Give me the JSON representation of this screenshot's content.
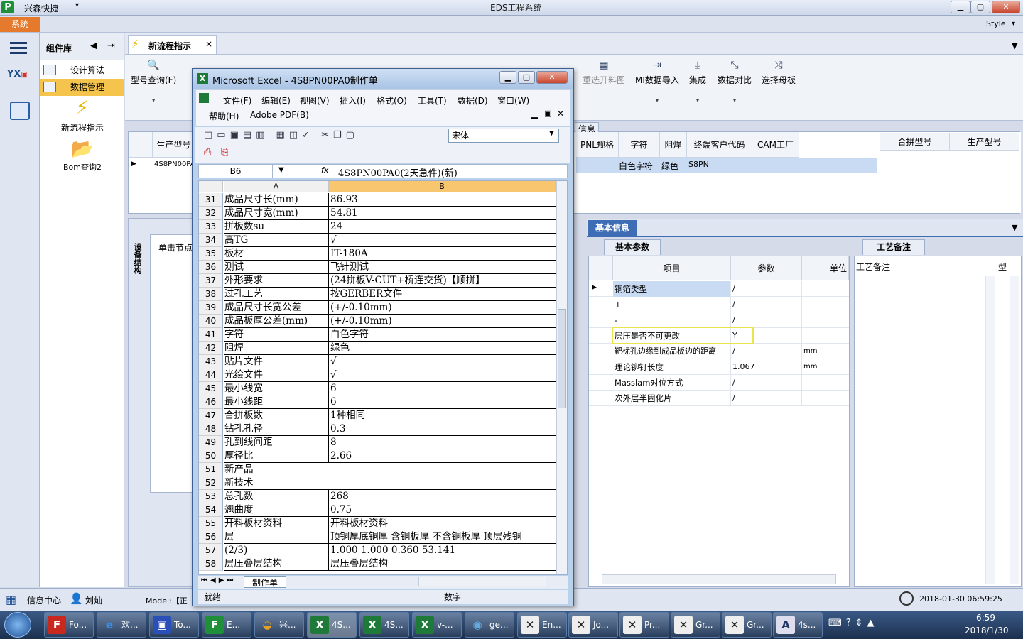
{
  "titlebar": {
    "app_name": "兴森快捷",
    "center_title": "EDS工程系统",
    "min": "▁",
    "max": "▢",
    "close": "✕"
  },
  "menu": {
    "system": "系统",
    "style": "Style"
  },
  "compnav": {
    "title": "组件库",
    "items": [
      {
        "label": "设计算法"
      },
      {
        "label": "数据管理"
      }
    ],
    "big_items": [
      {
        "label": "新流程指示"
      },
      {
        "label": "Bom查询2"
      }
    ]
  },
  "main_tab": {
    "label": "新流程指示",
    "close": "×"
  },
  "ribbon": {
    "left_btn": "型号查询(F)",
    "right_btns": [
      {
        "label": "重选开料图"
      },
      {
        "label": "MI数据导入"
      },
      {
        "label": "集成"
      },
      {
        "label": "数据对比"
      },
      {
        "label": "选择母板"
      }
    ]
  },
  "gridtop": {
    "info_label": "信息",
    "left_header": "生产型号",
    "left_value": "4S8PN00PA",
    "headers": [
      "PNL规格",
      "字符",
      "阻焊",
      "终端客户代码",
      "CAM工厂",
      "合拼型号",
      "生产型号"
    ],
    "row": [
      "",
      "白色字符",
      "绿色",
      "S8PN",
      ""
    ]
  },
  "lowerleft": {
    "vertical_tab": "设备结构",
    "node_hint": "单击节点"
  },
  "info_panel": {
    "tab": "基本信息",
    "sub_tab": "基本参数"
  },
  "param_grid": {
    "headers": [
      "项目",
      "参数",
      "单位"
    ],
    "rows": [
      {
        "item": "铜箔类型",
        "param": "/",
        "unit": ""
      },
      {
        "item": "+",
        "param": "/",
        "unit": ""
      },
      {
        "item": "-",
        "param": "/",
        "unit": ""
      },
      {
        "item": "层压是否不可更改",
        "param": "Y",
        "unit": ""
      },
      {
        "item": "靶标孔边缘到成品板边的距离",
        "param": "/",
        "unit": "mm"
      },
      {
        "item": "理论铆钉长度",
        "param": "1.067",
        "unit": "mm"
      },
      {
        "item": "Masslam对位方式",
        "param": "/",
        "unit": ""
      },
      {
        "item": "次外层半固化片",
        "param": "/",
        "unit": ""
      }
    ]
  },
  "craft_panel": {
    "tab": "工艺备注",
    "header": "工艺备注",
    "col2": "型"
  },
  "statusbar": {
    "info_center": "信息中心",
    "user": "刘灿",
    "model_prefix": "Model:【正",
    "datetime": "2018-01-30 06:59:25"
  },
  "taskbar": {
    "items": [
      "Fo...",
      "欢...",
      "To...",
      "E...",
      "兴...",
      "4S...",
      "4S...",
      "v-...",
      "ge...",
      "En...",
      "Jo...",
      "Pr...",
      "Gr...",
      "Gr...",
      "4s..."
    ],
    "time": "6:59",
    "date": "2018/1/30"
  },
  "excel": {
    "title": "Microsoft Excel - 4S8PN00PA0制作单",
    "menus1": [
      "文件(F)",
      "编辑(E)",
      "视图(V)",
      "插入(I)",
      "格式(O)",
      "工具(T)",
      "数据(D)",
      "窗口(W)"
    ],
    "menus2": [
      "帮助(H)",
      "Adobe PDF(B)"
    ],
    "font": "宋体",
    "namebox": "B6",
    "fx": "fx",
    "formula": "4S8PN00PA0(2天急件)(新)",
    "col_a": "A",
    "col_b": "B",
    "rows": [
      {
        "n": "31",
        "a": "成品尺寸长(mm)",
        "b": "86.93"
      },
      {
        "n": "32",
        "a": "成品尺寸宽(mm)",
        "b": "54.81"
      },
      {
        "n": "33",
        "a": "拼板数su",
        "b": "24"
      },
      {
        "n": "34",
        "a": "高TG",
        "b": "√"
      },
      {
        "n": "35",
        "a": "板材",
        "b": "IT-180A"
      },
      {
        "n": "36",
        "a": "测试",
        "b": "飞针测试"
      },
      {
        "n": "37",
        "a": "外形要求",
        "b": "(24拼板V-CUT+桥连交货)【顺拼】"
      },
      {
        "n": "38",
        "a": "过孔工艺",
        "b": "按GERBER文件"
      },
      {
        "n": "39",
        "a": "成品尺寸长宽公差",
        "b": "(+/-0.10mm)"
      },
      {
        "n": "40",
        "a": "成品板厚公差(mm)",
        "b": "(+/-0.10mm)"
      },
      {
        "n": "41",
        "a": "字符",
        "b": "白色字符"
      },
      {
        "n": "42",
        "a": "阻焊",
        "b": "绿色"
      },
      {
        "n": "43",
        "a": "贴片文件",
        "b": "√"
      },
      {
        "n": "44",
        "a": "光绘文件",
        "b": "√"
      },
      {
        "n": "45",
        "a": "最小线宽",
        "b": "6"
      },
      {
        "n": "46",
        "a": "最小线距",
        "b": "6"
      },
      {
        "n": "47",
        "a": "合拼板数",
        "b": "1种相同"
      },
      {
        "n": "48",
        "a": "钻孔孔径",
        "b": "0.3"
      },
      {
        "n": "49",
        "a": "孔到线间距",
        "b": "8"
      },
      {
        "n": "50",
        "a": "厚径比",
        "b": "2.66"
      },
      {
        "n": "51",
        "a": "新产品",
        "b": ""
      },
      {
        "n": "52",
        "a": "新技术",
        "b": ""
      },
      {
        "n": "53",
        "a": "总孔数",
        "b": "268"
      },
      {
        "n": "54",
        "a": "翘曲度",
        "b": "0.75"
      },
      {
        "n": "55",
        "a": "开料板材资料",
        "b": "开料板材资料"
      },
      {
        "n": "56",
        "a": "层",
        "b": "顶铜厚底铜厚 含铜板厚 不含铜板厚 顶层残铜"
      },
      {
        "n": "57",
        "a": "(2/3)",
        "b": "1.000  1.000       0.360     53.141"
      },
      {
        "n": "58",
        "a": "层压叠层结构",
        "b": "层压叠层结构"
      }
    ],
    "sheet_tab": "制作单",
    "status_ready": "就绪",
    "status_num": "数字"
  }
}
